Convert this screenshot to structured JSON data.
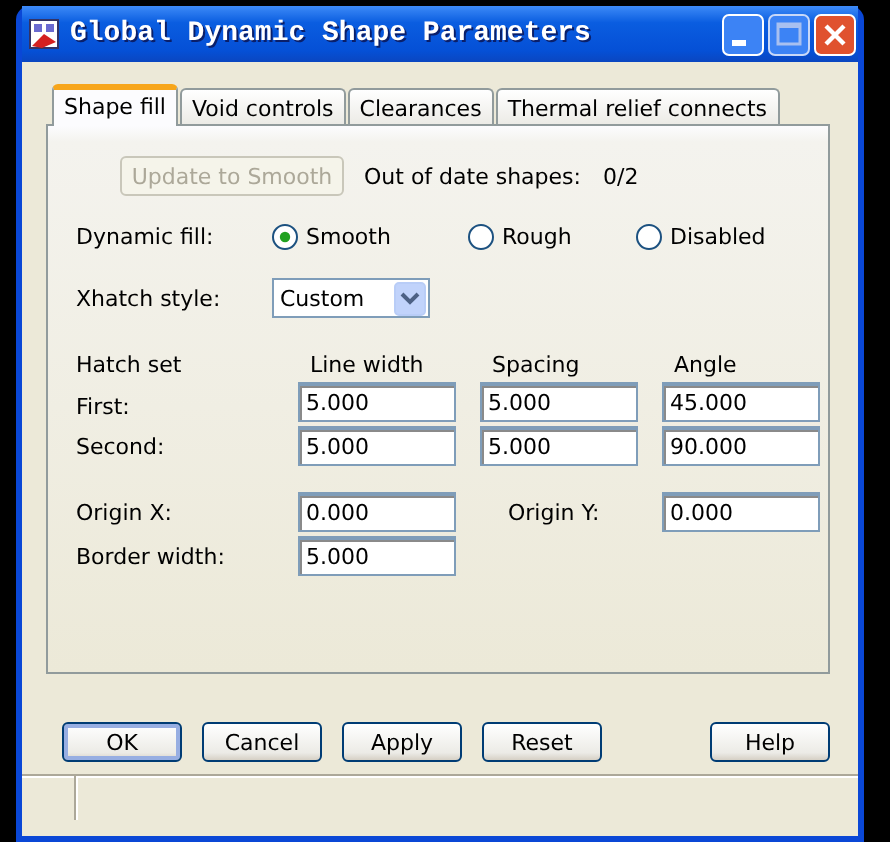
{
  "window": {
    "title": "Global Dynamic Shape Parameters"
  },
  "tabs": [
    {
      "label": "Shape fill",
      "selected": true
    },
    {
      "label": "Void controls",
      "selected": false
    },
    {
      "label": "Clearances",
      "selected": false
    },
    {
      "label": "Thermal relief connects",
      "selected": false
    }
  ],
  "update_button": {
    "label": "Update to Smooth",
    "disabled": true
  },
  "out_of_date": {
    "label": "Out of date shapes:",
    "value": "0/2"
  },
  "dynamic_fill": {
    "label": "Dynamic fill:",
    "options": [
      {
        "label": "Smooth",
        "selected": true
      },
      {
        "label": "Rough",
        "selected": false
      },
      {
        "label": "Disabled",
        "selected": false
      }
    ]
  },
  "xhatch_style": {
    "label": "Xhatch style:",
    "value": "Custom"
  },
  "hatch_table": {
    "columns": [
      "Hatch set",
      "Line width",
      "Spacing",
      "Angle"
    ],
    "rows": [
      {
        "label": "First:",
        "values": [
          "5.000",
          "5.000",
          "45.000"
        ]
      },
      {
        "label": "Second:",
        "values": [
          "5.000",
          "5.000",
          "90.000"
        ]
      }
    ]
  },
  "origin_x": {
    "label": "Origin X:",
    "value": "0.000"
  },
  "origin_y": {
    "label": "Origin Y:",
    "value": "0.000"
  },
  "border_width": {
    "label": "Border width:",
    "value": "5.000"
  },
  "buttons": [
    {
      "label": "OK",
      "default": true
    },
    {
      "label": "Cancel",
      "default": false
    },
    {
      "label": "Apply",
      "default": false
    },
    {
      "label": "Reset",
      "default": false
    },
    {
      "label": "Help",
      "default": false,
      "kind": "right"
    }
  ]
}
